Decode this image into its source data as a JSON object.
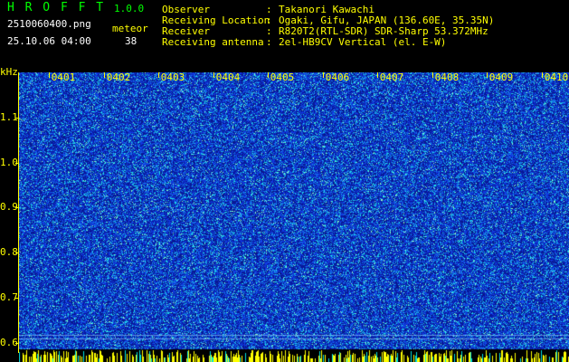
{
  "header": {
    "app_name": "H R O F F T",
    "version": "1.0.0",
    "file_name": "2510060400.png",
    "datetime": "25.10.06 04:00",
    "detection_label": "meteor",
    "detection_count": "38"
  },
  "info": {
    "observer_label": "Observer",
    "observer_sep": ":",
    "observer_value": "Takanori Kawachi",
    "location_label": "Receiving Location",
    "location_sep": ":",
    "location_value": "Ogaki, Gifu, JAPAN (136.60E, 35.35N)",
    "receiver_label": "Receiver",
    "receiver_sep": ":",
    "receiver_value": "R820T2(RTL-SDR) SDR-Sharp 53.372MHz",
    "antenna_label": "Receiving antenna",
    "antenna_sep": ":",
    "antenna_value": "2el-HB9CV Vertical (el. E-W)"
  },
  "axes": {
    "unit": "kHz",
    "y_ticks": [
      "1.1",
      "1.0",
      "0.9",
      "0.8",
      "0.7",
      "0.6"
    ],
    "x_ticks": [
      "0401",
      "0402",
      "0403",
      "0404",
      "0405",
      "0406",
      "0407",
      "0408",
      "0409",
      "0410"
    ]
  },
  "colors": {
    "background": "#000000",
    "text_green": "#00ff00",
    "text_yellow": "#ffff00",
    "spectrogram_base": "#1030b0",
    "spectrogram_noise": "#00e8e8",
    "baseline_bars": "#ffff00"
  }
}
